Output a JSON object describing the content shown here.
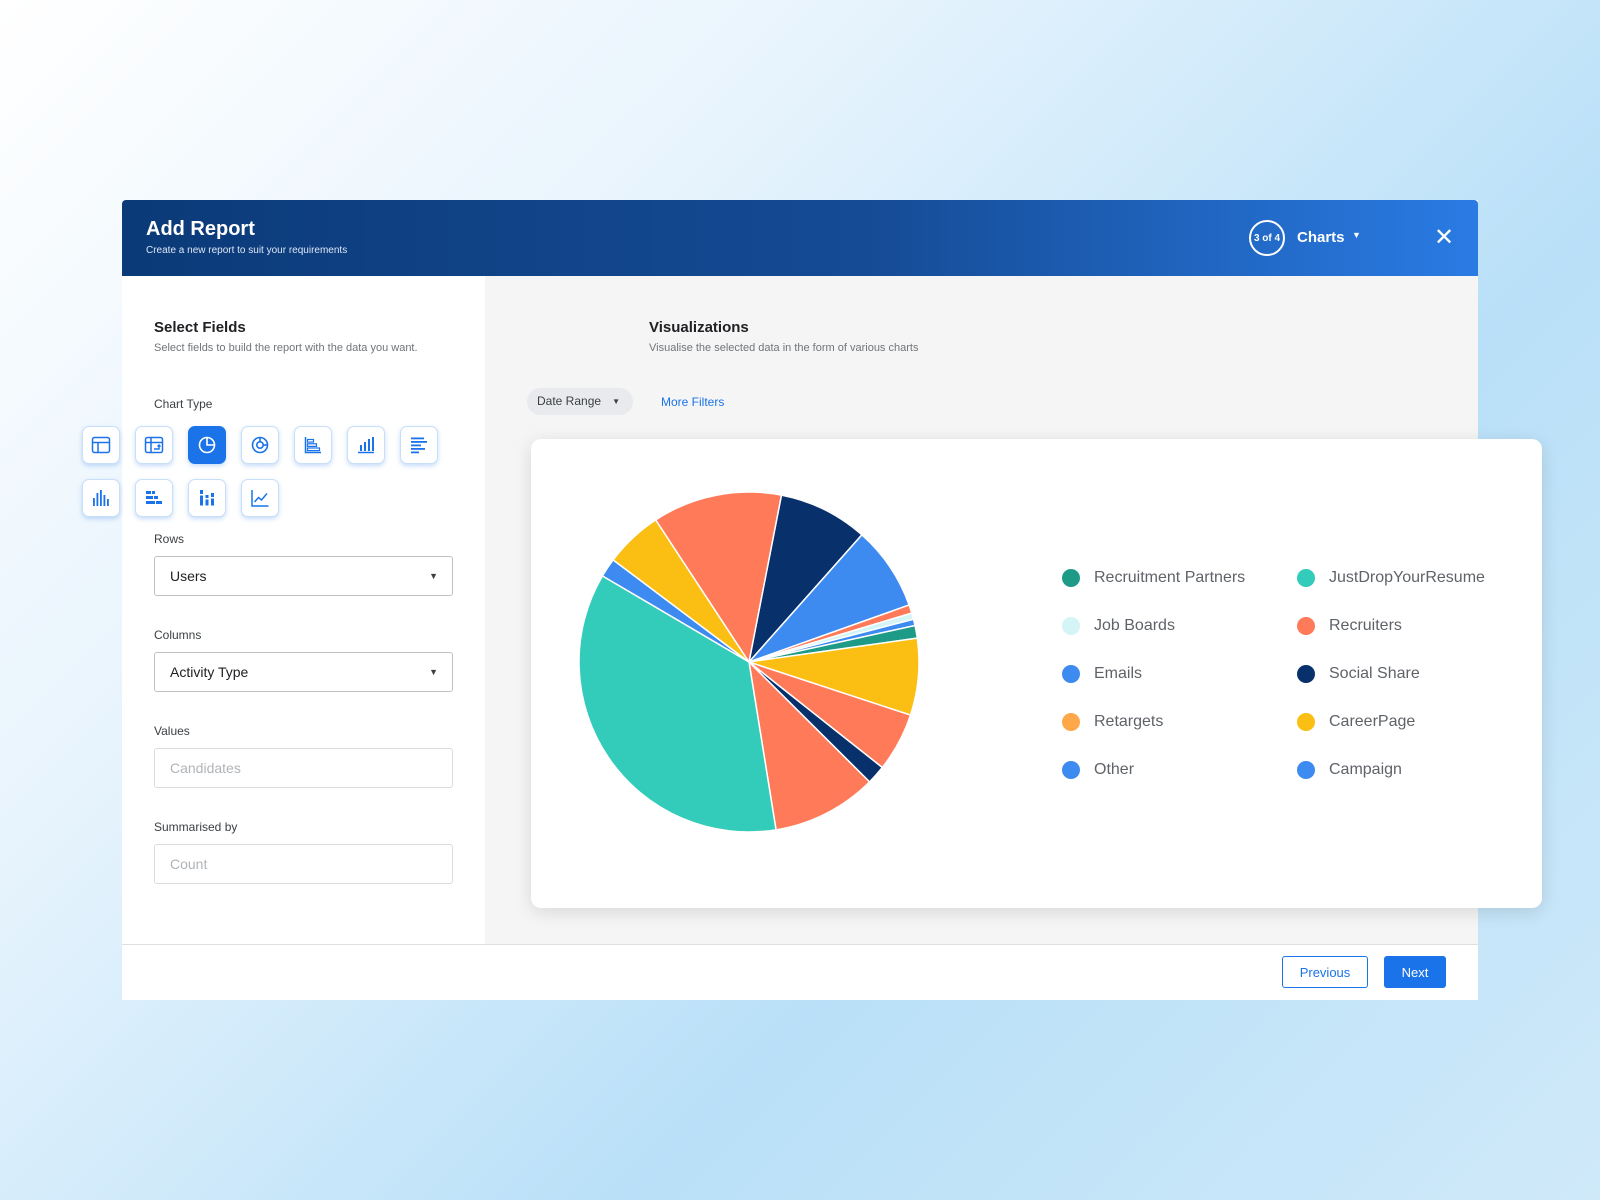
{
  "header": {
    "title": "Add Report",
    "subtitle": "Create a new report to suit your requirements",
    "step": "3 of 4",
    "step_label": "Charts"
  },
  "left": {
    "title": "Select Fields",
    "subtitle": "Select fields to build the report with the data you want.",
    "chart_type_label": "Chart Type",
    "chart_types": [
      {
        "name": "table-icon",
        "selected": false
      },
      {
        "name": "pivot-table-icon",
        "selected": false
      },
      {
        "name": "pie-chart-icon",
        "selected": true
      },
      {
        "name": "donut-chart-icon",
        "selected": false
      },
      {
        "name": "horizontal-bar-chart-icon",
        "selected": false
      },
      {
        "name": "column-chart-icon",
        "selected": false
      },
      {
        "name": "bar-list-icon",
        "selected": false
      },
      {
        "name": "histogram-icon",
        "selected": false
      },
      {
        "name": "stacked-bar-chart-icon",
        "selected": false
      },
      {
        "name": "stacked-column-chart-icon",
        "selected": false
      },
      {
        "name": "line-chart-icon",
        "selected": false
      }
    ],
    "rows_label": "Rows",
    "rows_value": "Users",
    "columns_label": "Columns",
    "columns_value": "Activity Type",
    "values_label": "Values",
    "values_placeholder": "Candidates",
    "summarised_label": "Summarised by",
    "summarised_placeholder": "Count"
  },
  "right": {
    "title": "Visualizations",
    "subtitle": "Visualise the selected data in the form of various charts",
    "date_range": "Date Range",
    "more_filters": "More Filters"
  },
  "chart_data": {
    "type": "pie",
    "slices": [
      {
        "label": "Social Share",
        "value": 8.5,
        "color": "#08306b"
      },
      {
        "label": "Emails",
        "value": 8.0,
        "color": "#3d8bf0"
      },
      {
        "label": "Recruiters",
        "value": 0.8,
        "color": "#ff7a59"
      },
      {
        "label": "Job Boards",
        "value": 0.6,
        "color": "#d4f4f6"
      },
      {
        "label": "Campaign",
        "value": 0.6,
        "color": "#3d8bf0"
      },
      {
        "label": "Recruitment Partners",
        "value": 1.2,
        "color": "#1e9b87"
      },
      {
        "label": "CareerPage",
        "value": 7.3,
        "color": "#fbbf14"
      },
      {
        "label": "Recruiters",
        "value": 5.6,
        "color": "#ff7a59"
      },
      {
        "label": "Social Share",
        "value": 1.8,
        "color": "#08306b"
      },
      {
        "label": "Recruiters",
        "value": 10.0,
        "color": "#ff7a59"
      },
      {
        "label": "JustDropYourResume",
        "value": 36.0,
        "color": "#33cbb9"
      },
      {
        "label": "Other",
        "value": 1.8,
        "color": "#3d8bf0"
      },
      {
        "label": "CareerPage",
        "value": 5.5,
        "color": "#fbbf14"
      },
      {
        "label": "Recruiters",
        "value": 12.3,
        "color": "#ff7a59"
      }
    ],
    "legend": [
      {
        "label": "Recruitment Partners",
        "color": "#1e9b87"
      },
      {
        "label": "JustDropYourResume",
        "color": "#33cbb9"
      },
      {
        "label": "Job Boards",
        "color": "#d4f4f6"
      },
      {
        "label": "Recruiters",
        "color": "#ff7a59"
      },
      {
        "label": "Emails",
        "color": "#3d8bf0"
      },
      {
        "label": "Social Share",
        "color": "#08306b"
      },
      {
        "label": "Retargets",
        "color": "#ffa84a"
      },
      {
        "label": "CareerPage",
        "color": "#fbbf14"
      },
      {
        "label": "Other",
        "color": "#3d8bf0"
      },
      {
        "label": "Campaign",
        "color": "#3d8bf0"
      }
    ]
  },
  "footer": {
    "previous": "Previous",
    "next": "Next"
  }
}
